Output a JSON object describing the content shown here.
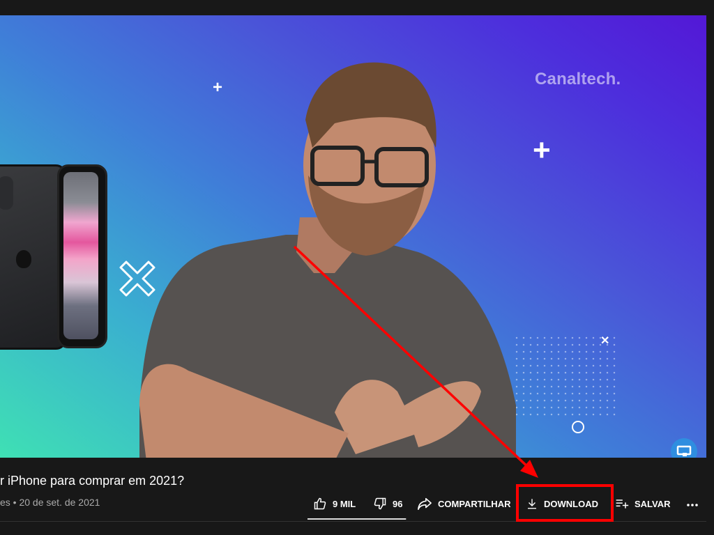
{
  "video": {
    "brand": "Canaltech.",
    "colors": {
      "grad_start": "#3fe0b4",
      "grad_end": "#5318d6",
      "badge": "#2f8ee0"
    }
  },
  "info": {
    "title": "r iPhone para comprar em 2021?",
    "meta": "es • 20 de set. de 2021"
  },
  "actions": {
    "like_count": "9 MIL",
    "like_fill": 0.99,
    "dislike_count": "96",
    "share_label": "COMPARTILHAR",
    "download_label": "DOWNLOAD",
    "save_label": "SALVAR",
    "more_label": "..."
  },
  "annotation": {
    "color": "#ff0000",
    "target": "download-button"
  },
  "icons": [
    "thumb-up-icon",
    "thumb-down-icon",
    "share-icon",
    "download-icon",
    "playlist-add-icon",
    "more-icon",
    "channel-badge-icon"
  ]
}
